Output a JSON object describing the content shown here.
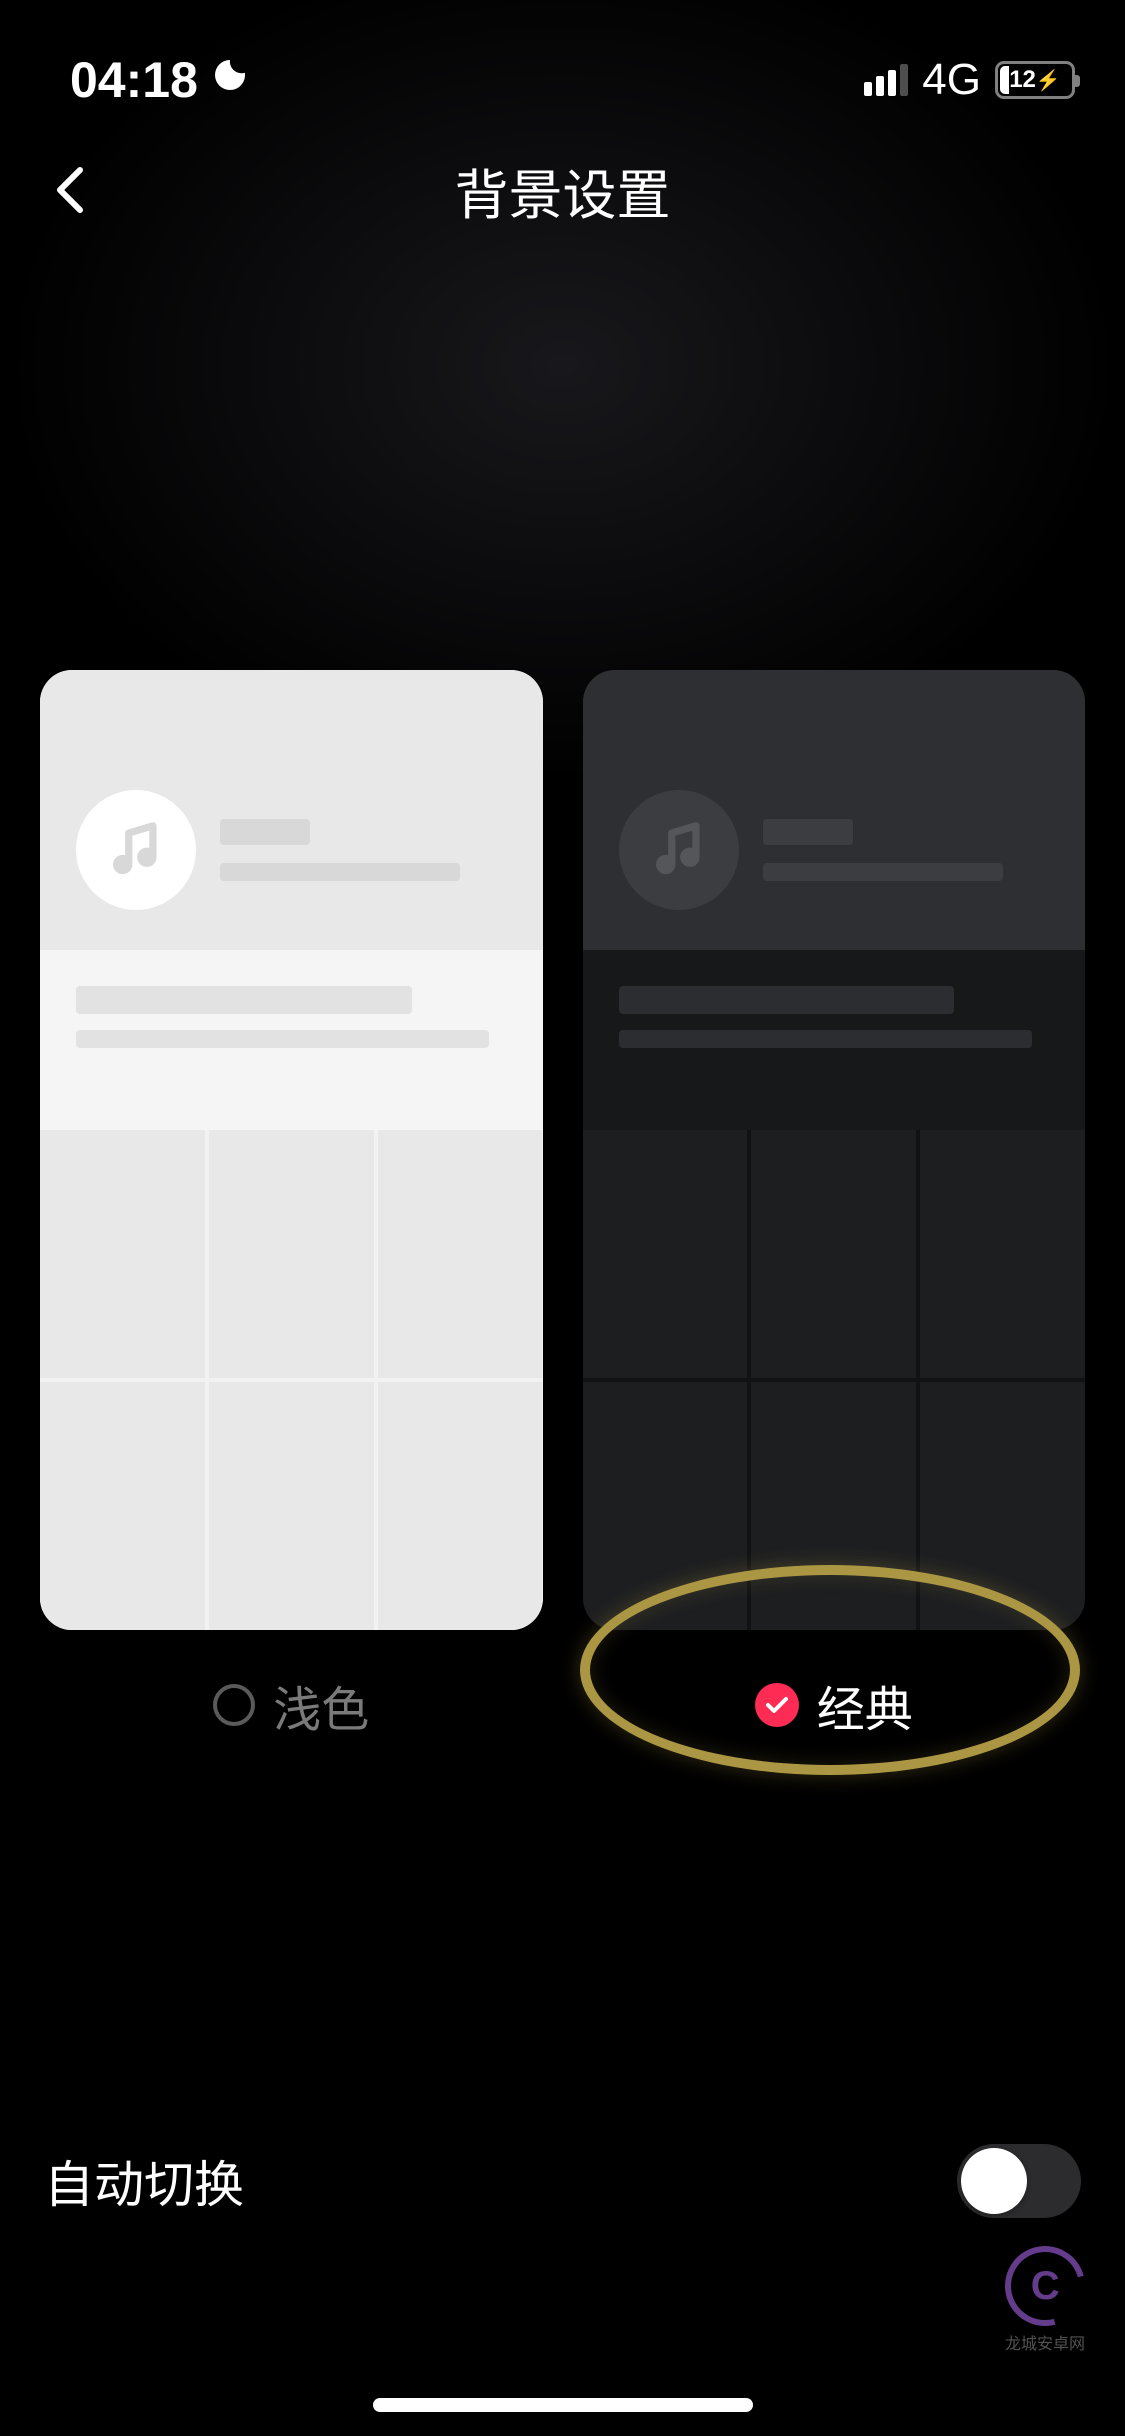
{
  "status_bar": {
    "time": "04:18",
    "network_type": "4G",
    "battery_percent": "12"
  },
  "header": {
    "title": "背景设置"
  },
  "themes": {
    "light": {
      "label": "浅色",
      "selected": false
    },
    "dark": {
      "label": "经典",
      "selected": true
    }
  },
  "auto_switch": {
    "label": "自动切换",
    "enabled": false
  },
  "watermark": {
    "text": "龙城安卓网"
  }
}
